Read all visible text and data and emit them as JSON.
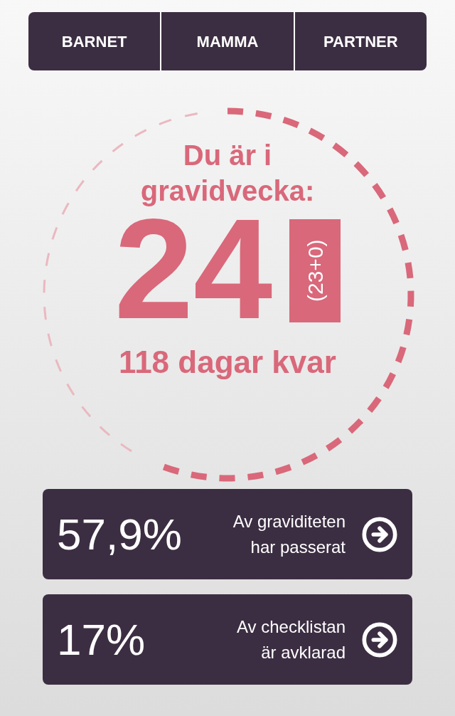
{
  "tabs": [
    {
      "label": "BARNET"
    },
    {
      "label": "MAMMA"
    },
    {
      "label": "PARTNER"
    }
  ],
  "progress": {
    "title": "Du är i gravidvecka:",
    "week": "24",
    "week_detail": "(23+0)",
    "days_left": "118 dagar kvar"
  },
  "cards": [
    {
      "value": "57,9%",
      "lines": [
        "Av graviditeten",
        "har passerat"
      ]
    },
    {
      "value": "17%",
      "lines": [
        "Av checklistan",
        "är avklarad"
      ]
    }
  ]
}
